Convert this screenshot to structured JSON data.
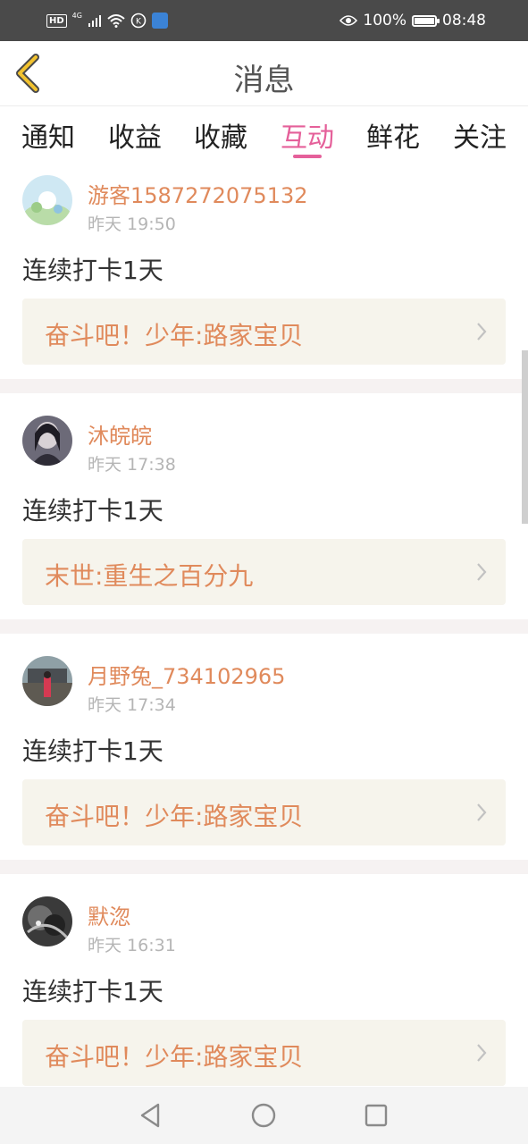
{
  "status_bar": {
    "hd": "HD",
    "network": "4G",
    "battery_percent": "100%",
    "time": "08:48",
    "icons": [
      "signal-icon",
      "wifi-icon",
      "data-speed-icon",
      "app-notification-icon",
      "eye-icon",
      "battery-icon"
    ]
  },
  "header": {
    "title": "消息",
    "back_icon": "chevron-left-icon"
  },
  "tabs": [
    {
      "label": "通知",
      "active": false
    },
    {
      "label": "收益",
      "active": false
    },
    {
      "label": "收藏",
      "active": false
    },
    {
      "label": "互动",
      "active": true
    },
    {
      "label": "鲜花",
      "active": false
    },
    {
      "label": "关注",
      "active": false
    }
  ],
  "messages": [
    {
      "user": "游客1587272075132",
      "time": "昨天 19:50",
      "text": "连续打卡1天",
      "book": "奋斗吧！少年:路家宝贝"
    },
    {
      "user": "沐皖皖",
      "time": "昨天 17:38",
      "text": "连续打卡1天",
      "book": "末世:重生之百分九"
    },
    {
      "user": "月野兔_734102965",
      "time": "昨天 17:34",
      "text": "连续打卡1天",
      "book": "奋斗吧！少年:路家宝贝"
    },
    {
      "user": "默淴",
      "time": "昨天 16:31",
      "text": "连续打卡1天",
      "book": "奋斗吧！少年:路家宝贝"
    }
  ],
  "nav_bar": {
    "icons": [
      "back-triangle-icon",
      "home-circle-icon",
      "recents-square-icon"
    ]
  },
  "colors": {
    "accent": "#e5609a",
    "username": "#e08a5c",
    "book_title": "#e08a5c",
    "book_card_bg": "#f6f4ec",
    "status_bar_bg": "#4a4a4a",
    "back_arrow": "#f2c22e"
  }
}
